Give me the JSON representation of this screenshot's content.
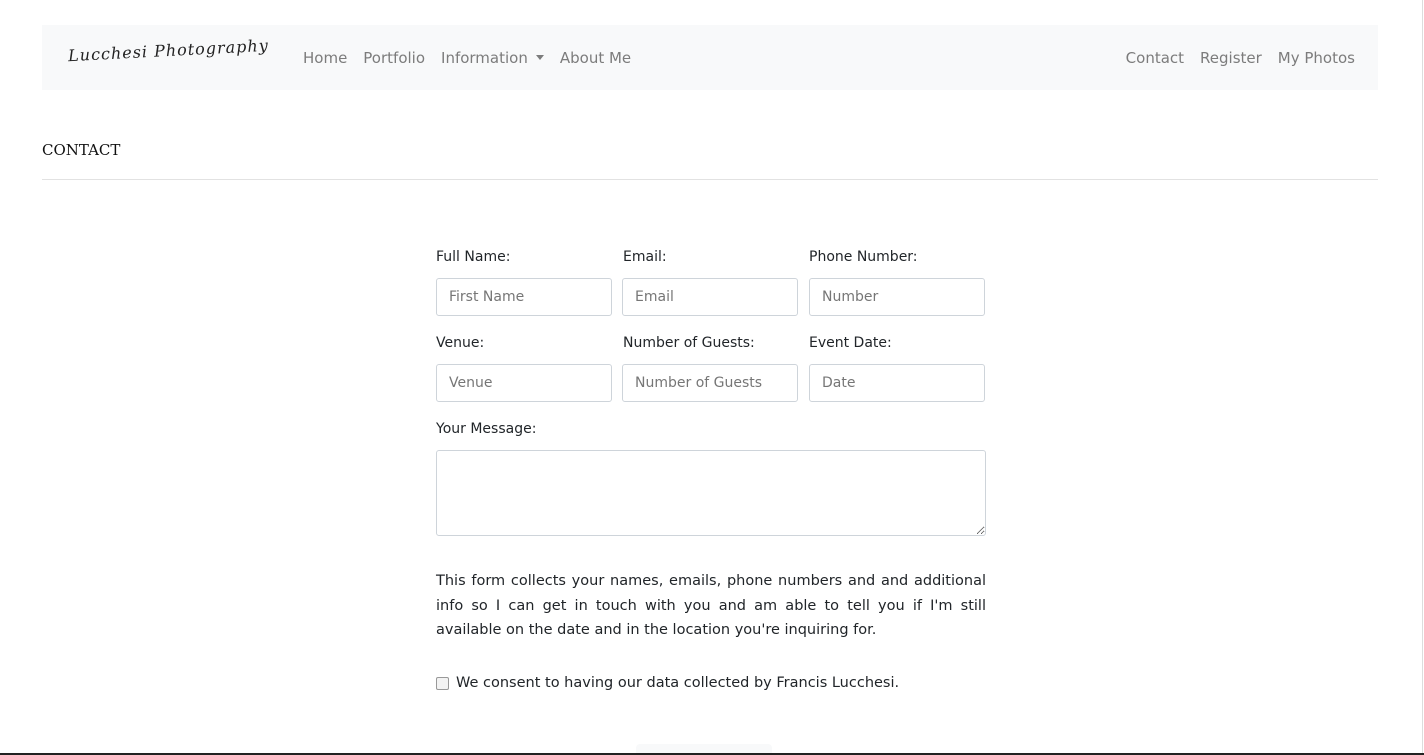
{
  "nav": {
    "brand": "Lucchesi Photography",
    "left": [
      "Home",
      "Portfolio",
      "Information",
      "About Me"
    ],
    "right": [
      "Contact",
      "Register",
      "My Photos"
    ]
  },
  "heading": "CONTACT",
  "form": {
    "full_name": {
      "label": "Full Name:",
      "placeholder": "First Name"
    },
    "email": {
      "label": "Email:",
      "placeholder": "Email"
    },
    "phone": {
      "label": "Phone Number:",
      "placeholder": "Number"
    },
    "venue": {
      "label": "Venue:",
      "placeholder": "Venue"
    },
    "guests": {
      "label": "Number of Guests:",
      "placeholder": "Number of Guests"
    },
    "date": {
      "label": "Event Date:",
      "placeholder": "Date"
    },
    "message": {
      "label": "Your Message:"
    },
    "notice": "This form collects your names, emails, phone numbers and and additional info so I can get in touch with you and am able to tell you if I'm still available on the date and in the location you're inquiring for.",
    "consent": "We consent to having our data collected by Francis Lucchesi."
  }
}
